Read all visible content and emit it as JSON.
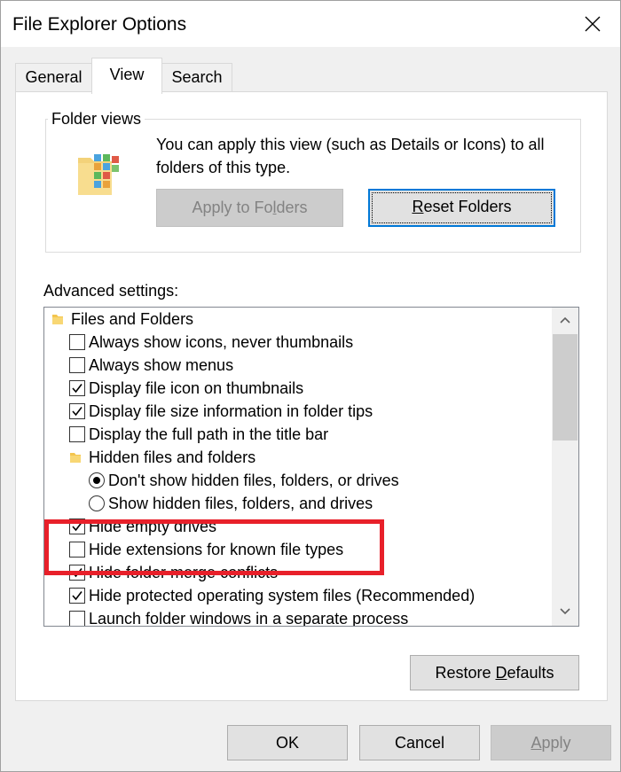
{
  "window": {
    "title": "File Explorer Options"
  },
  "tabs": [
    {
      "label": "General",
      "selected": false
    },
    {
      "label": "View",
      "selected": true
    },
    {
      "label": "Search",
      "selected": false
    }
  ],
  "folder_views": {
    "group_label": "Folder views",
    "description": "You can apply this view (such as Details or Icons) to all folders of this type.",
    "apply_button": {
      "pre": "Apply to Fo",
      "accel": "l",
      "post": "ders",
      "enabled": false
    },
    "reset_button": {
      "pre": "",
      "accel": "R",
      "post": "eset Folders",
      "enabled": true
    }
  },
  "advanced": {
    "label": "Advanced settings:",
    "items": [
      {
        "type": "folder",
        "label": "Files and Folders",
        "indent": 0
      },
      {
        "type": "checkbox",
        "label": "Always show icons, never thumbnails",
        "checked": false,
        "indent": 1
      },
      {
        "type": "checkbox",
        "label": "Always show menus",
        "checked": false,
        "indent": 1
      },
      {
        "type": "checkbox",
        "label": "Display file icon on thumbnails",
        "checked": true,
        "indent": 1
      },
      {
        "type": "checkbox",
        "label": "Display file size information in folder tips",
        "checked": true,
        "indent": 1
      },
      {
        "type": "checkbox",
        "label": "Display the full path in the title bar",
        "checked": false,
        "indent": 1
      },
      {
        "type": "folder",
        "label": "Hidden files and folders",
        "indent": 1
      },
      {
        "type": "radio",
        "label": "Don't show hidden files, folders, or drives",
        "checked": true,
        "indent": 2
      },
      {
        "type": "radio",
        "label": "Show hidden files, folders, and drives",
        "checked": false,
        "indent": 2
      },
      {
        "type": "checkbox",
        "label": "Hide empty drives",
        "checked": true,
        "indent": 1
      },
      {
        "type": "checkbox",
        "label": "Hide extensions for known file types",
        "checked": false,
        "indent": 1
      },
      {
        "type": "checkbox",
        "label": "Hide folder merge conflicts",
        "checked": true,
        "indent": 1
      },
      {
        "type": "checkbox",
        "label": "Hide protected operating system files (Recommended)",
        "checked": true,
        "indent": 1
      },
      {
        "type": "checkbox",
        "label": "Launch folder windows in a separate process",
        "checked": false,
        "indent": 1
      }
    ]
  },
  "buttons": {
    "restore": {
      "pre": "Restore ",
      "accel": "D",
      "post": "efaults"
    },
    "ok": {
      "pre": "OK",
      "accel": "",
      "post": ""
    },
    "cancel": {
      "pre": "Cancel",
      "accel": "",
      "post": ""
    },
    "apply": {
      "pre": "",
      "accel": "A",
      "post": "pply",
      "enabled": false
    }
  },
  "colors": {
    "accent": "#0078d7",
    "highlight": "#e8202a",
    "disabled_text": "#838383"
  }
}
